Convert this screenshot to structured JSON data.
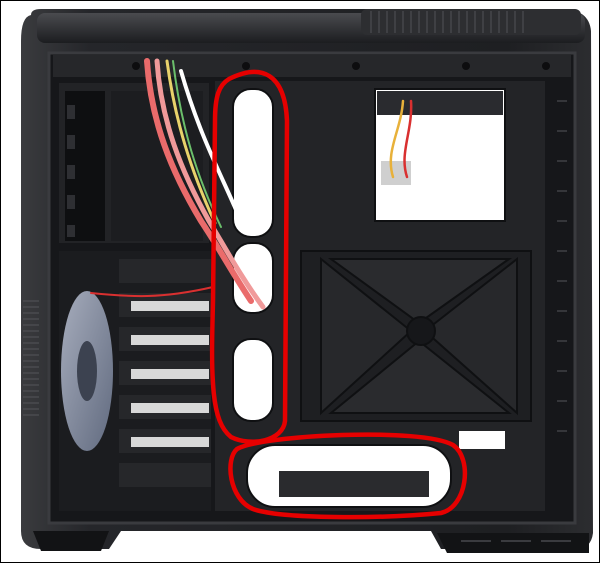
{
  "image": {
    "subject": "pc-case-side-view",
    "annotation_color": "#e60000",
    "case_color": "#1f2022",
    "background_color": "#ffffff"
  }
}
